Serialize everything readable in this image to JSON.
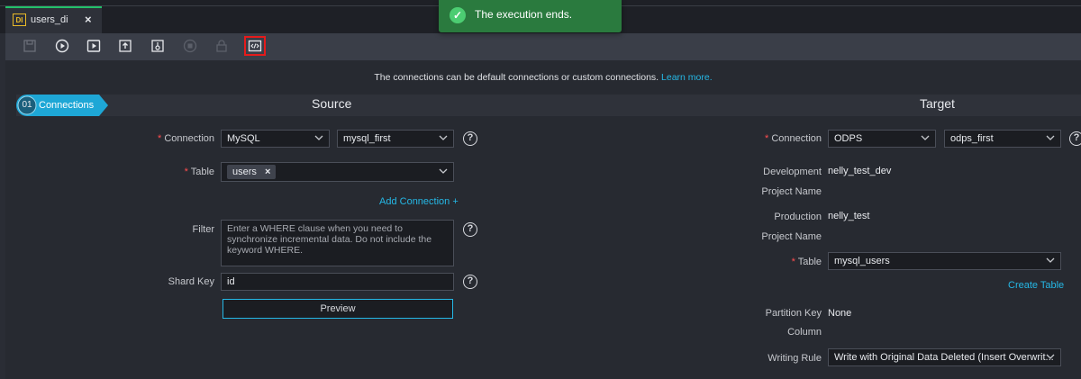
{
  "tab": {
    "icon_text": "DI",
    "label": "users_di",
    "close": "×"
  },
  "toolbar": {
    "buttons": [
      "save-icon",
      "run-icon",
      "run-with-params-icon",
      "submit-icon",
      "publish-icon",
      "stop-icon",
      "lock-icon",
      "code-editor-icon"
    ],
    "highlighted": "code-editor-icon"
  },
  "toast": {
    "message": "The execution ends.",
    "icon": "check-icon",
    "color": "#2a7a3e"
  },
  "info": {
    "text": "The connections can be default connections or custom connections.",
    "link": "Learn more."
  },
  "step": {
    "number": "01",
    "label": "Connections"
  },
  "source": {
    "title": "Source",
    "connection_label": "Connection",
    "connection_type": "MySQL",
    "connection_name": "mysql_first",
    "table_label": "Table",
    "table_tag": "users",
    "table_tag_remove": "×",
    "add_connection": "Add Connection +",
    "filter_label": "Filter",
    "filter_placeholder": "Enter a WHERE clause when you need to synchronize incremental data. Do not include the keyword WHERE.",
    "shard_key_label": "Shard Key",
    "shard_key_value": "id",
    "preview_button": "Preview"
  },
  "target": {
    "title": "Target",
    "connection_label": "Connection",
    "connection_type": "ODPS",
    "connection_name": "odps_first",
    "dev_label_1": "Development",
    "dev_label_2": "Project Name",
    "dev_value": "nelly_test_dev",
    "prod_label_1": "Production",
    "prod_label_2": "Project Name",
    "prod_value": "nelly_test",
    "table_label": "Table",
    "table_value": "mysql_users",
    "create_table": "Create Table",
    "partition_label_1": "Partition Key",
    "partition_label_2": "Column",
    "partition_value": "None",
    "writing_rule_label": "Writing Rule",
    "writing_rule_value": "Write with Original Data Deleted (Insert Overwrit..."
  },
  "colors": {
    "accent": "#25b8e6",
    "success": "#23c16b",
    "required": "#ff4d4f",
    "highlight": "#e51b1b"
  }
}
